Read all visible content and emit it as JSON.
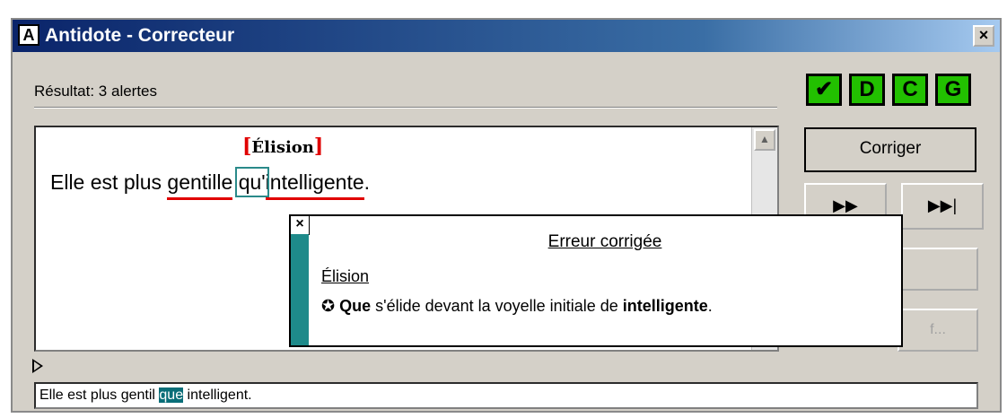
{
  "window": {
    "title": "Antidote - Correcteur",
    "app_icon": "A",
    "close_glyph": "×"
  },
  "result": {
    "label": "Résultat: 3 alertes"
  },
  "flag_buttons": [
    {
      "label": "✔",
      "icon": "check-icon"
    },
    {
      "label": "D"
    },
    {
      "label": "C"
    },
    {
      "label": "G"
    }
  ],
  "editor": {
    "annotation_label": "Élision",
    "sentence": {
      "part1": "Elle est plus ",
      "word_error1": "gentille",
      "space": " ",
      "word_boxed": "qu'",
      "word_error2": "intelligente",
      "end": "."
    }
  },
  "popup": {
    "close_glyph": "×",
    "title": "Erreur corrigée",
    "category": "Élision",
    "bullet": "✪",
    "expl_bold1": "Que",
    "expl_mid": " s'élide devant la voyelle initiale de ",
    "expl_bold2": "intelligente",
    "expl_end": "."
  },
  "buttons": {
    "corriger": "Corriger",
    "next": "▶▶",
    "last": "▶▶|",
    "ghost2": "f..."
  },
  "output": {
    "before": "Elle est plus gentil ",
    "highlight": "que",
    "after": " intelligent."
  },
  "colors": {
    "title_gradient_start": "#0a246a",
    "flag_green": "#22c000",
    "error_red": "#e00000",
    "teal": "#1e8a8a",
    "window_gray": "#d4d0c8"
  }
}
